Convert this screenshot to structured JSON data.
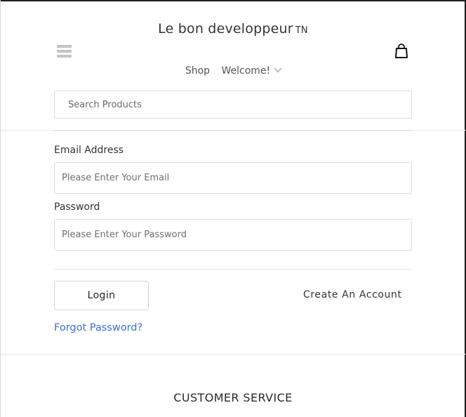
{
  "header": {
    "brand_name": "Le bon developpeur",
    "brand_suffix": "TN",
    "menu_icon": "hamburger-menu-icon",
    "cart_icon": "shopping-bag-icon"
  },
  "nav": {
    "shop_label": "Shop",
    "welcome_label": "Welcome!",
    "dropdown_icon": "chevron-down-icon"
  },
  "search": {
    "placeholder": "Search Products"
  },
  "login_form": {
    "email_label": "Email Address",
    "email_placeholder": "Please Enter Your Email",
    "password_label": "Password",
    "password_placeholder": "Please Enter Your Password",
    "login_button": "Login",
    "create_account_link": "Create An Account",
    "forgot_password_link": "Forgot Password?"
  },
  "footer": {
    "section_heading": "CUSTOMER SERVICE"
  },
  "colors": {
    "link": "#3b6fd6",
    "border": "#dcdcdc",
    "menu_icon": "#c4c4c4",
    "text": "#333333"
  }
}
